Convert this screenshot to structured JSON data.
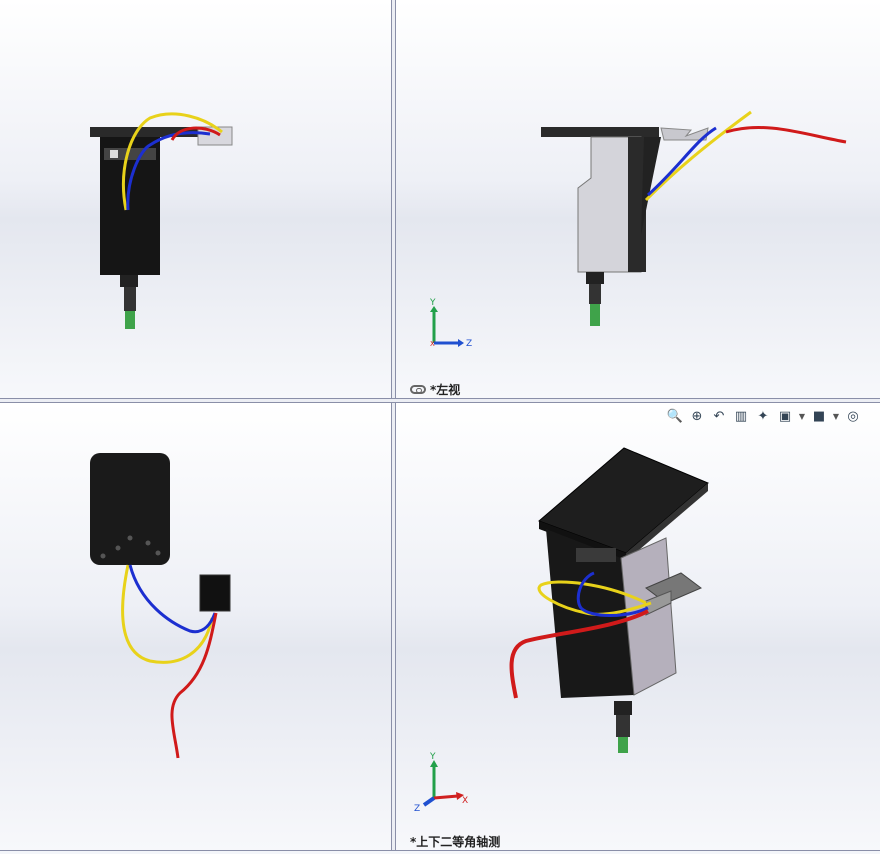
{
  "viewports": {
    "left_view_label": "*左视",
    "isometric_view_label": "*上下二等角轴测"
  },
  "triad": {
    "axis_y": "Y",
    "axis_z": "Z",
    "axis_x": "X"
  },
  "heads_up_toolbar": {
    "tools": [
      "zoom-to-fit-icon",
      "zoom-to-area-icon",
      "previous-view-icon",
      "section-view-icon",
      "dynamic-annotation-icon",
      "view-orientation-icon",
      "display-style-icon",
      "hide-show-icon"
    ]
  },
  "colors": {
    "body": "#1a1a1a",
    "plate_side": "#cfcfd6",
    "wire_yellow": "#e8d21a",
    "wire_blue": "#1c2fd0",
    "wire_red": "#d01a1a",
    "connector_green": "#4caf50",
    "triad_y": "#22a04a",
    "triad_z": "#2050d0",
    "triad_x": "#d02020"
  }
}
